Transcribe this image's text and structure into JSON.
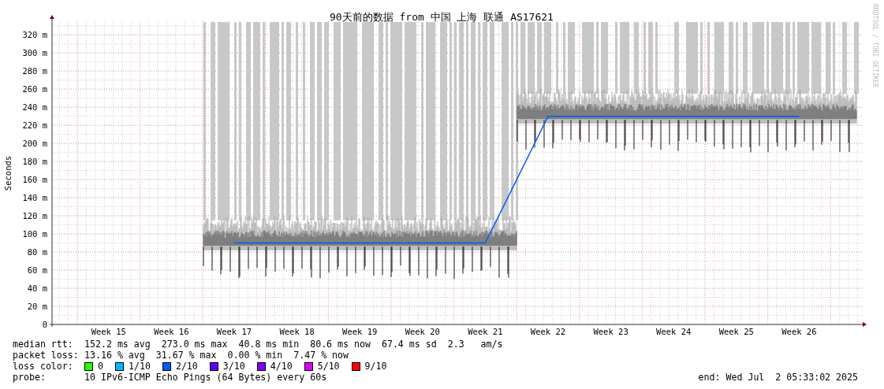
{
  "graph": {
    "credit": "RRDTOOL / TOBI OETIKER",
    "chart_data": {
      "type": "line",
      "title": "90天前的数据 from 中国 上海 联通 AS17621",
      "ylabel": "Seconds",
      "categories": [
        "Week 15",
        "Week 16",
        "Week 17",
        "Week 18",
        "Week 19",
        "Week 20",
        "Week 21",
        "Week 22",
        "Week 23",
        "Week 24",
        "Week 25",
        "Week 26"
      ],
      "grid": true,
      "series": [
        {
          "color": "#0059ff",
          "values": [
            null,
            null,
            90,
            90,
            90,
            90,
            90,
            230,
            230,
            230,
            230,
            230
          ]
        }
      ],
      "ylim": [
        0,
        335
      ],
      "yticks": [
        {
          "value": 0,
          "label": "0"
        },
        {
          "value": 20,
          "label": "20 m"
        },
        {
          "value": 40,
          "label": "40 m"
        },
        {
          "value": 60,
          "label": "60 m"
        },
        {
          "value": 80,
          "label": "80 m"
        },
        {
          "value": 100,
          "label": "100 m"
        },
        {
          "value": 120,
          "label": "120 m"
        },
        {
          "value": 140,
          "label": "140 m"
        },
        {
          "value": 160,
          "label": "160 m"
        },
        {
          "value": 180,
          "label": "180 m"
        },
        {
          "value": 200,
          "label": "200 m"
        },
        {
          "value": 220,
          "label": "220 m"
        },
        {
          "value": 240,
          "label": "240 m"
        },
        {
          "value": 260,
          "label": "260 m"
        },
        {
          "value": 280,
          "label": "280 m"
        },
        {
          "value": 300,
          "label": "300 m"
        },
        {
          "value": 320,
          "label": "320 m"
        }
      ]
    }
  },
  "legend": {
    "rows": [
      {
        "label": "median rtt:",
        "value": "152.2 ms avg  273.0 ms max  40.8 ms min  80.6 ms now  67.4 ms sd  2.3   am/s"
      },
      {
        "label": "packet loss:",
        "value": "13.16 % avg  31.67 % max  0.00 % min  7.47 % now"
      }
    ],
    "loss_colors": {
      "label": "loss color:",
      "items": [
        {
          "label": "0",
          "color": "#26ff00"
        },
        {
          "label": "1/10",
          "color": "#00b8ff"
        },
        {
          "label": "2/10",
          "color": "#0059ff"
        },
        {
          "label": "3/10",
          "color": "#5e00ff"
        },
        {
          "label": "4/10",
          "color": "#7e00ff"
        },
        {
          "label": "5/10",
          "color": "#dd00ff"
        },
        {
          "label": "9/10",
          "color": "#ff0000"
        }
      ]
    },
    "probe": {
      "label": "probe:",
      "value": "10 IPv6-ICMP Echo Pings (64 Bytes) every 60s",
      "end": "end: Wed Jul  2 05:33:02 2025"
    }
  }
}
